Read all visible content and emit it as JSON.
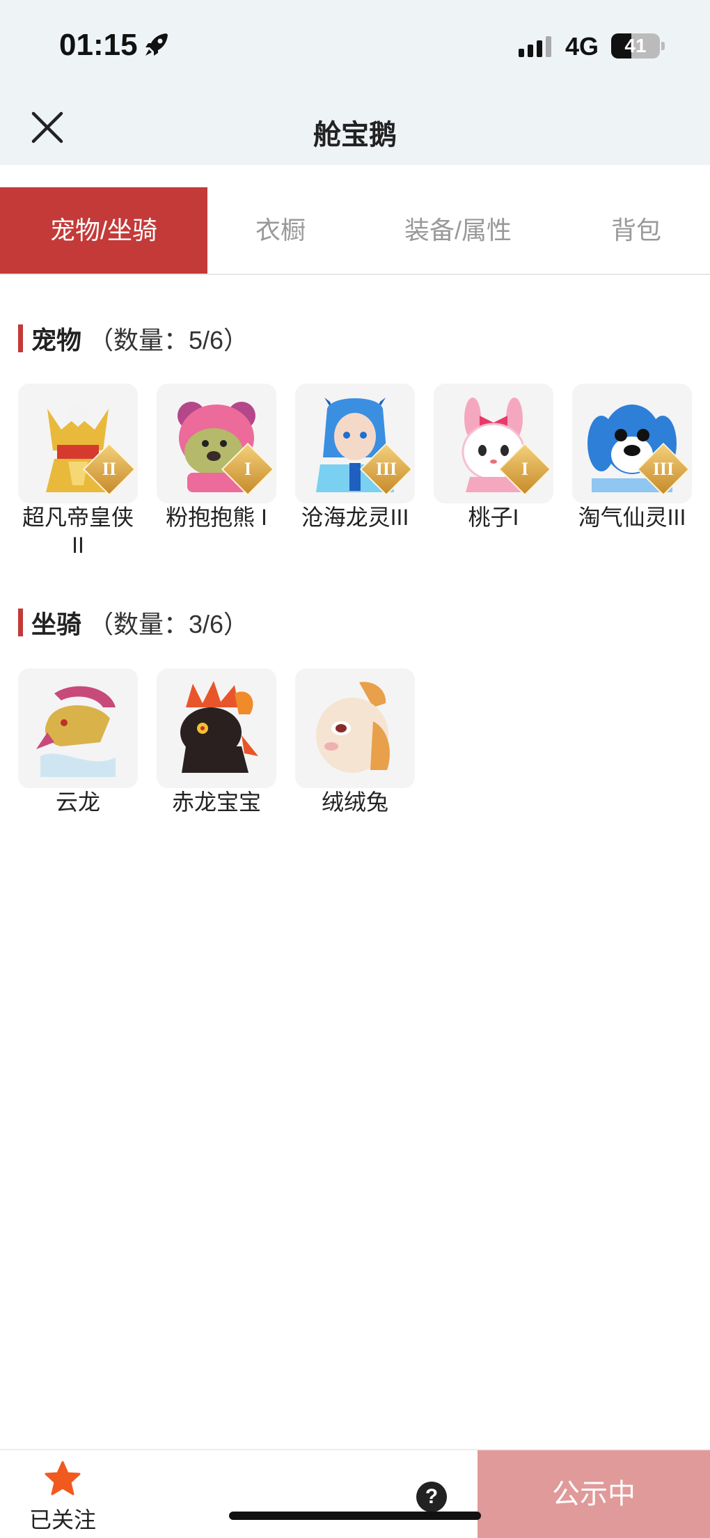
{
  "status": {
    "time": "01:15",
    "network": "4G",
    "battery": "41",
    "battery_level": 0.41
  },
  "nav": {
    "title": "舱宝鹅"
  },
  "tabs": [
    {
      "label": "宠物/坐骑",
      "active": true
    },
    {
      "label": "衣橱",
      "active": false
    },
    {
      "label": "装备/属性",
      "active": false
    },
    {
      "label": "背包",
      "active": false
    }
  ],
  "pets": {
    "title": "宠物",
    "count": "（数量：5/6）",
    "items": [
      {
        "name": "超凡帝皇侠II",
        "tier": "II",
        "icon": "golden-armored-hero-icon",
        "colors": [
          "#e8b93a",
          "#d63a2e"
        ]
      },
      {
        "name": "粉抱抱熊 I",
        "tier": "I",
        "icon": "pink-bear-icon",
        "colors": [
          "#ec6b9a",
          "#b5b96a"
        ]
      },
      {
        "name": "沧海龙灵III",
        "tier": "III",
        "icon": "sea-dragon-spirit-icon",
        "colors": [
          "#3a8fe0",
          "#7ad0f0"
        ]
      },
      {
        "name": "桃子I",
        "tier": "I",
        "icon": "bunny-girl-icon",
        "colors": [
          "#f5a7c0",
          "#ffffff"
        ]
      },
      {
        "name": "淘气仙灵III",
        "tier": "III",
        "icon": "blue-spirit-dog-icon",
        "colors": [
          "#2d7fd8",
          "#8fc6f2"
        ]
      }
    ]
  },
  "mounts": {
    "title": "坐骑",
    "count": "（数量：3/6）",
    "items": [
      {
        "name": "云龙",
        "icon": "cloud-dragon-icon",
        "colors": [
          "#c84a7a",
          "#d9b24a"
        ]
      },
      {
        "name": "赤龙宝宝",
        "icon": "red-dragon-baby-icon",
        "colors": [
          "#2a2020",
          "#e8552a"
        ]
      },
      {
        "name": "绒绒兔",
        "icon": "fluffy-rabbit-icon",
        "colors": [
          "#f5e4d2",
          "#e8a04a"
        ]
      }
    ]
  },
  "bottom": {
    "follow_label": "已关注",
    "help_label": "?",
    "public_label": "公示中"
  },
  "colors": {
    "accent": "#c33a38",
    "star": "#f05a1e",
    "public_button": "#e09a99"
  }
}
